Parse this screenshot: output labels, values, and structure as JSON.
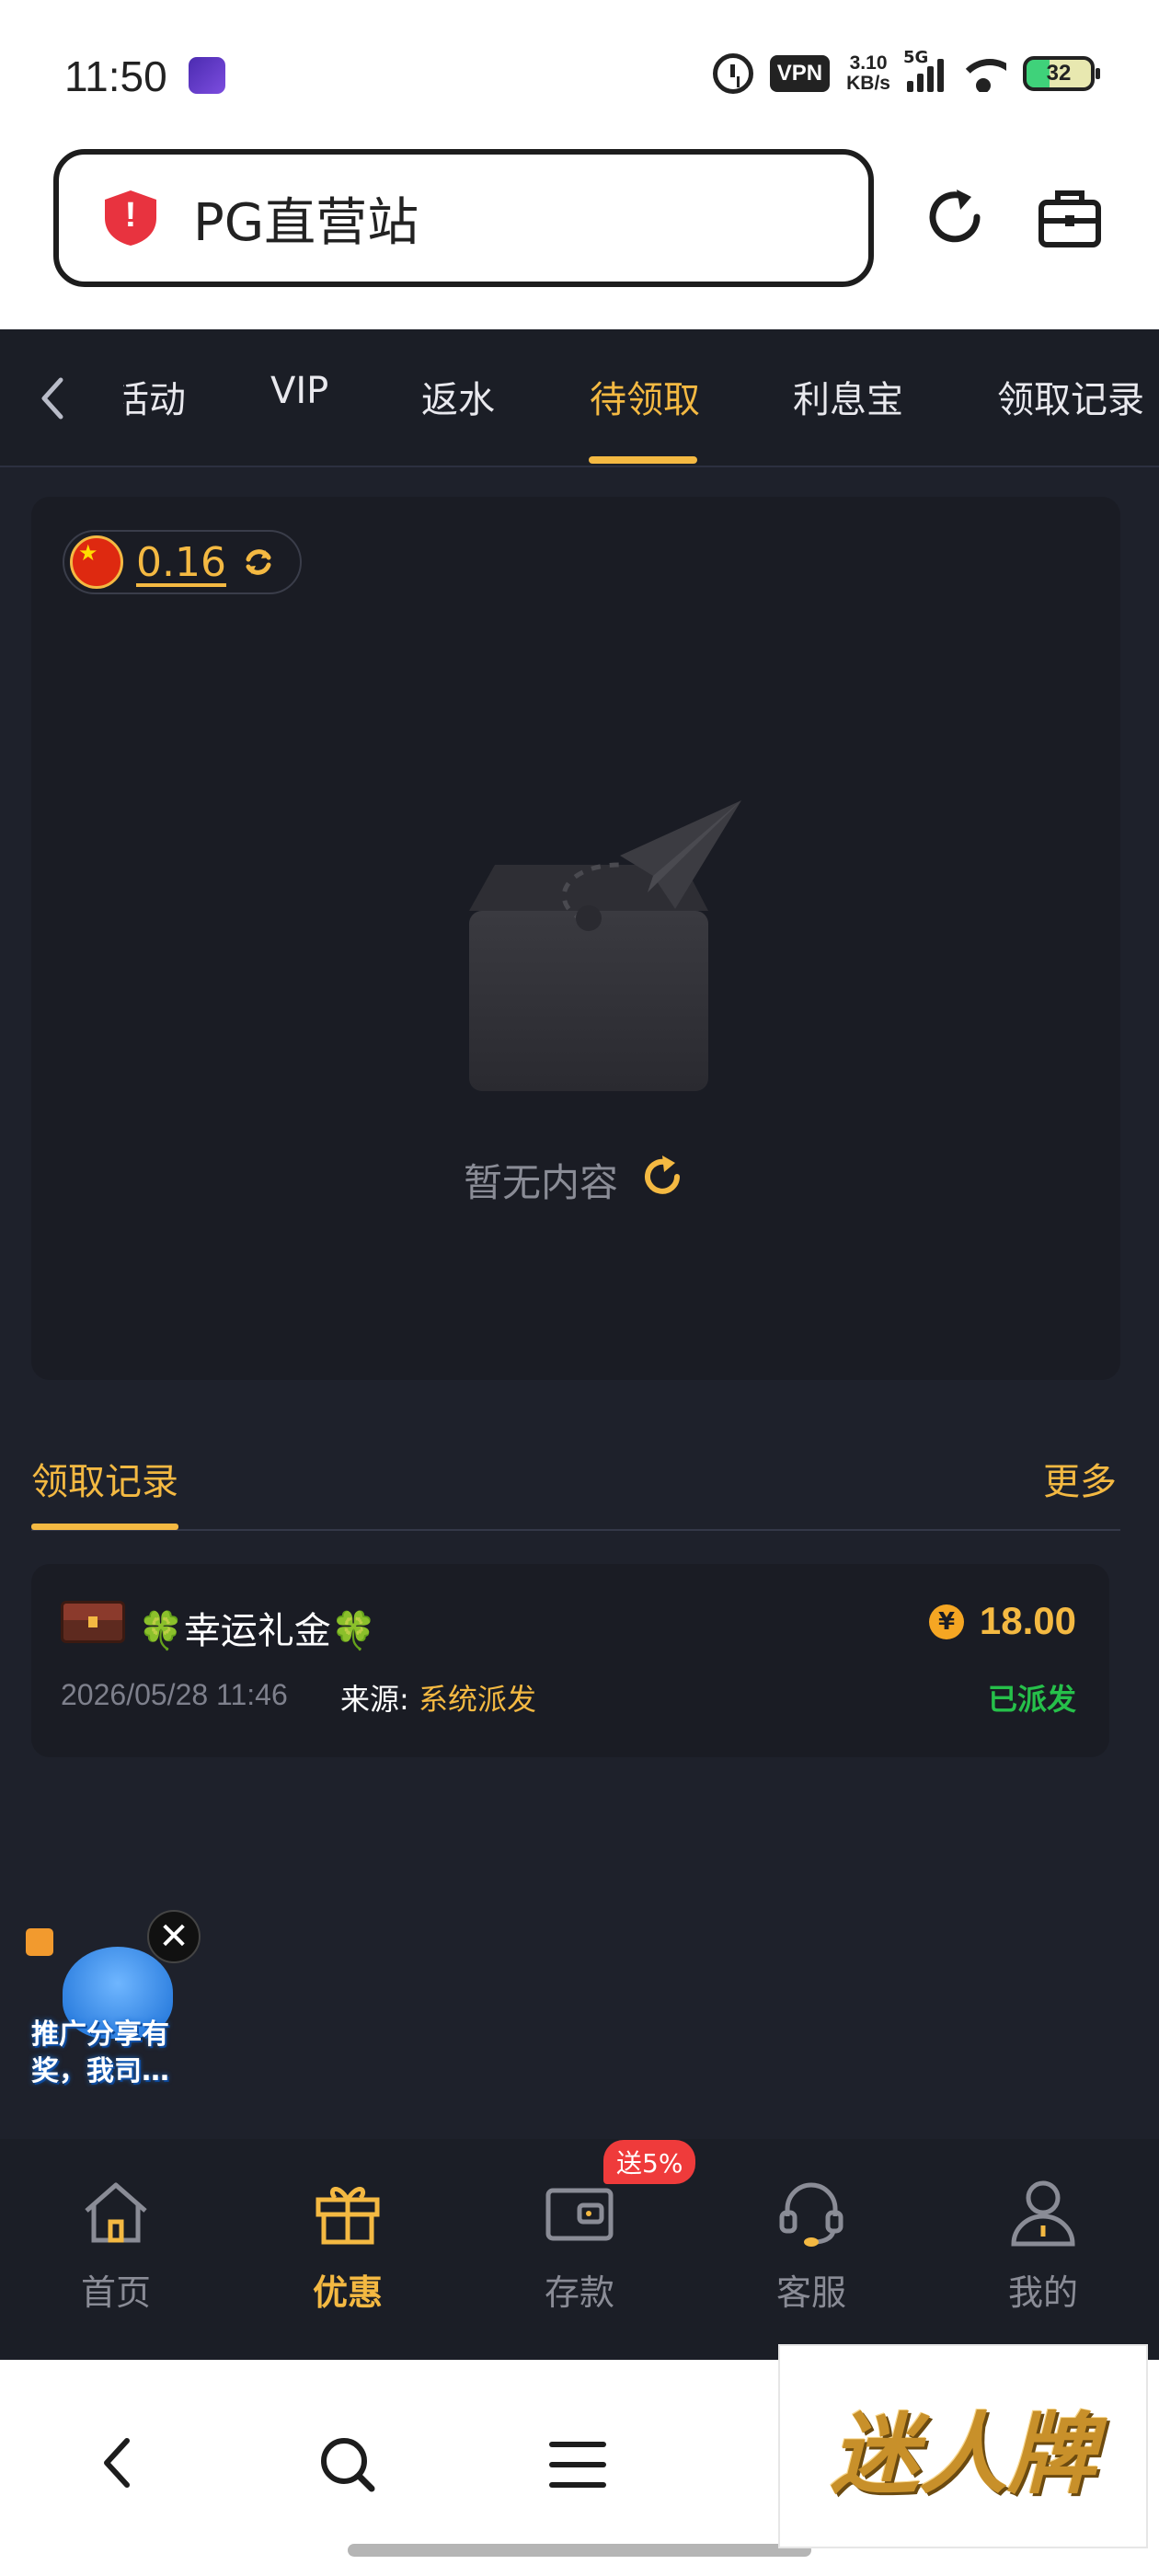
{
  "status_bar": {
    "time": "11:50",
    "vpn": "VPN",
    "speed_value": "3.10",
    "speed_unit": "KB/s",
    "network": "5G",
    "battery": "32"
  },
  "browser": {
    "url_title": "PG直营站",
    "icons": [
      "shield-alert-icon",
      "reload-icon",
      "briefcase-icon"
    ]
  },
  "tabs": {
    "items": [
      "活动",
      "VIP",
      "返水",
      "待领取",
      "利息宝",
      "领取记录"
    ],
    "active": "待领取"
  },
  "balance": {
    "currency_icon": "cn-flag-icon",
    "value": "0.16"
  },
  "empty_state": {
    "text": "暂无内容"
  },
  "records": {
    "title": "领取记录",
    "more": "更多",
    "items": [
      {
        "name_prefix": "🍀",
        "name": "幸运礼金",
        "name_suffix": "🍀",
        "amount": "18.00",
        "coin_symbol": "¥",
        "date": "2026/05/28 11:46",
        "source_label": "来源:",
        "source_value": "系统派发",
        "status": "已派发"
      }
    ]
  },
  "promo": {
    "text": "推广分享有奖，我司…",
    "close": "✕"
  },
  "bottom_nav": {
    "items": [
      "首页",
      "优惠",
      "存款",
      "客服",
      "我的"
    ],
    "active": "优惠",
    "badge": "送5%"
  },
  "watermark": {
    "text": "迷人牌"
  },
  "colors": {
    "accent": "#f4b942",
    "background": "#1e212b",
    "panel": "#1a1c24",
    "status_green": "#26c04a",
    "badge_red": "#ef3b3b"
  }
}
